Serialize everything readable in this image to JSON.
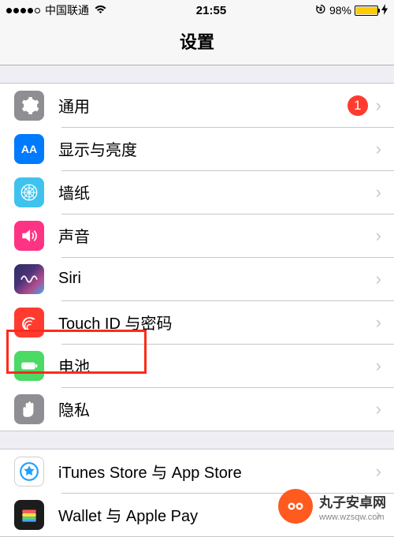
{
  "status": {
    "carrier": "中国联通",
    "time": "21:55",
    "battery_pct": "98%"
  },
  "nav": {
    "title": "设置"
  },
  "rows": {
    "general": {
      "label": "通用",
      "badge": "1"
    },
    "display": {
      "label": "显示与亮度"
    },
    "wallpaper": {
      "label": "墙纸"
    },
    "sound": {
      "label": "声音"
    },
    "siri": {
      "label": "Siri"
    },
    "touchid": {
      "label": "Touch ID 与密码"
    },
    "battery": {
      "label": "电池"
    },
    "privacy": {
      "label": "隐私"
    },
    "itunes": {
      "label": "iTunes Store 与 App Store"
    },
    "wallet": {
      "label": "Wallet 与 Apple Pay"
    }
  },
  "annotation": {
    "highlighted_row": "battery"
  },
  "watermark": {
    "brand": "丸子安卓网",
    "url": "www.wzsqw.com"
  }
}
